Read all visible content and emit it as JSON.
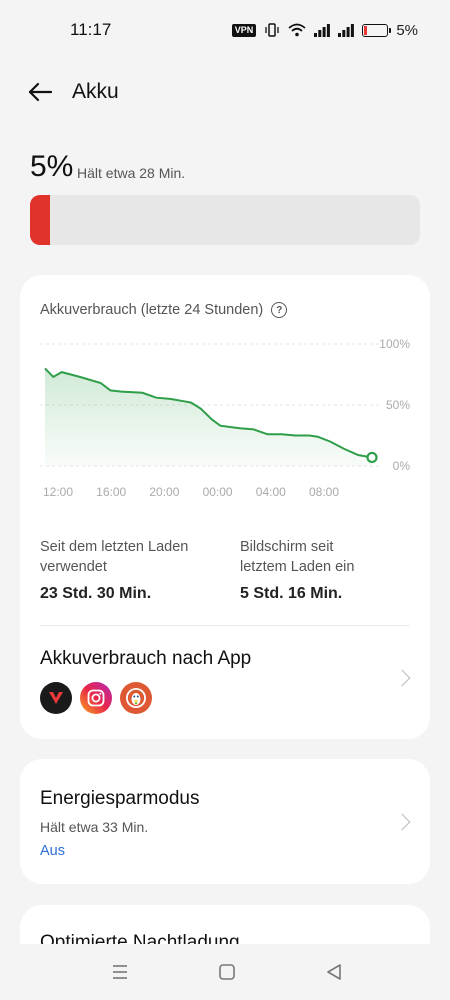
{
  "status_bar": {
    "time": "11:17",
    "vpn_label": "VPN",
    "battery_text": "5%"
  },
  "header": {
    "title": "Akku",
    "back_icon": "arrow-left-icon"
  },
  "battery": {
    "percent_text": "5%",
    "remaining_text": "Hält etwa 28 Min.",
    "level": 0.05,
    "bar_color": "#e0332c"
  },
  "usage_card": {
    "title": "Akkuverbrauch (letzte 24 Stunden)",
    "help_icon": "question-circle-icon",
    "chart_data": {
      "type": "area",
      "x_ticks": [
        "12:00",
        "16:00",
        "20:00",
        "00:00",
        "04:00",
        "08:00"
      ],
      "y_ticks": [
        "100%",
        "50%",
        "0%"
      ],
      "ylim": [
        0,
        100
      ],
      "grid": true,
      "line_color": "#2f9e49",
      "x_hours": [
        0,
        0.6,
        1.2,
        2.5,
        4,
        4.7,
        5.5,
        7,
        8,
        9,
        10,
        10.5,
        11.2,
        12,
        12.6,
        13.3,
        14,
        15,
        16,
        17,
        18,
        19,
        19.6,
        20.5,
        21.5,
        22.5,
        23.5
      ],
      "values": [
        80,
        73,
        77,
        73,
        68,
        62,
        61,
        60,
        56,
        55,
        53,
        52,
        47,
        38,
        33,
        32,
        31,
        30,
        26,
        26,
        25,
        25,
        24,
        20,
        14,
        9,
        7
      ]
    },
    "stats": [
      {
        "label_line1": "Seit dem letzten Laden",
        "label_line2": "verwendet",
        "value": "23 Std. 30 Min."
      },
      {
        "label_line1": "Bildschirm seit",
        "label_line2": "letztem Laden ein",
        "value": "5 Std. 16 Min."
      }
    ],
    "app_usage": {
      "title": "Akkuverbrauch nach App",
      "apps": [
        "vivaldi-icon",
        "instagram-icon",
        "duckduckgo-icon"
      ]
    }
  },
  "power_saver": {
    "title": "Energiesparmodus",
    "subtitle": "Hält etwa 33 Min.",
    "status": "Aus",
    "status_color": "#2f6fd6"
  },
  "night_charge": {
    "title": "Optimierte Nachtladung"
  },
  "nav": {
    "icons": [
      "menu-icon",
      "home-icon",
      "back-triangle-icon"
    ]
  }
}
